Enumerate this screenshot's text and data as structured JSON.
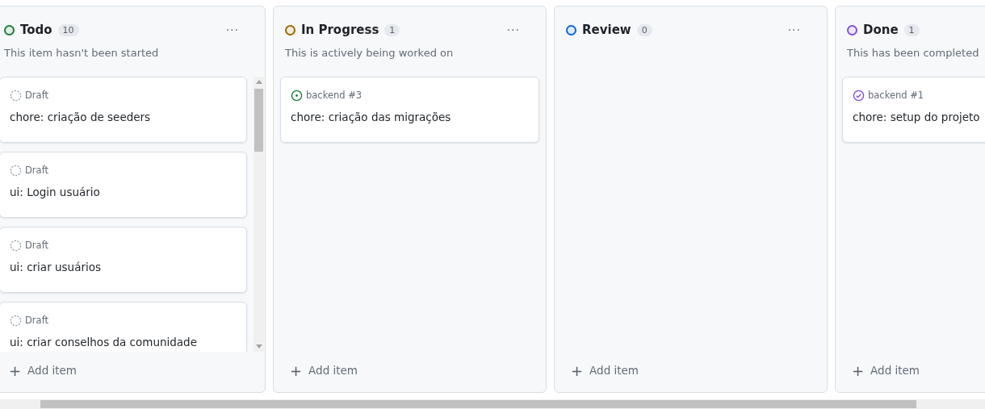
{
  "columns": [
    {
      "title": "Todo",
      "count": "10",
      "color": "#1a7f37",
      "description": "This item hasn't been started",
      "menu": "···",
      "scrollable": true,
      "add_label": "Add item",
      "add_icon": "+",
      "items": [
        {
          "kind": "draft",
          "meta": "Draft",
          "title": "chore: criação de seeders"
        },
        {
          "kind": "draft",
          "meta": "Draft",
          "title": "ui: Login usuário"
        },
        {
          "kind": "draft",
          "meta": "Draft",
          "title": "ui: criar usuários"
        },
        {
          "kind": "draft",
          "meta": "Draft",
          "title": "ui: criar conselhos da comunidade"
        }
      ]
    },
    {
      "title": "In Progress",
      "count": "1",
      "color": "#9a6700",
      "description": "This is actively being worked on",
      "menu": "···",
      "scrollable": false,
      "add_label": "Add item",
      "add_icon": "+",
      "items": [
        {
          "kind": "open",
          "meta": "backend #3",
          "title": "chore: criação das migrações"
        }
      ]
    },
    {
      "title": "Review",
      "count": "0",
      "color": "#0969da",
      "menu": "···",
      "scrollable": false,
      "add_label": "Add item",
      "add_icon": "+"
    },
    {
      "title": "Done",
      "count": "1",
      "color": "#8250df",
      "description": "This has been completed",
      "scrollable": false,
      "add_label": "Add item",
      "add_icon": "+",
      "items": [
        {
          "kind": "closed",
          "meta": "backend #1",
          "title": "chore: setup do projeto"
        }
      ]
    }
  ]
}
